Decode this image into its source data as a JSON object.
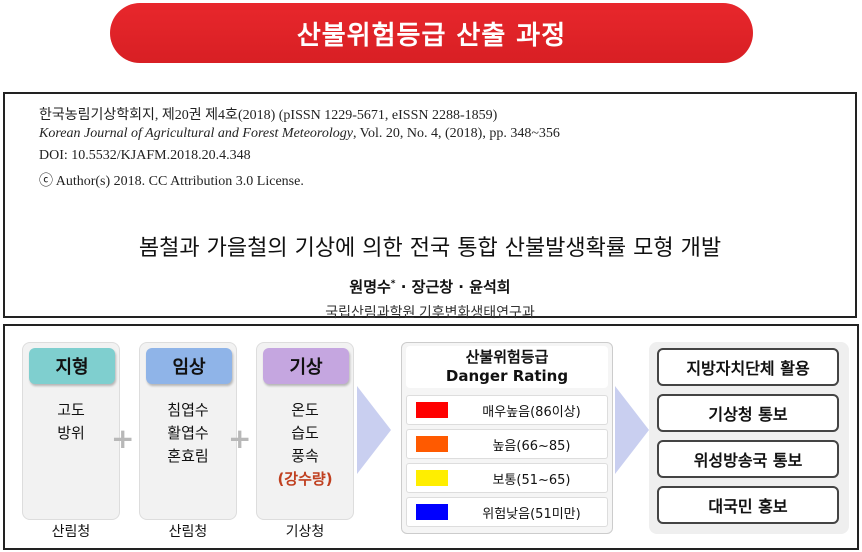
{
  "title": "산불위험등급 산출 과정",
  "paper": {
    "line1": "한국농림기상학회지,  제20권  제4호(2018)  (pISSN  1229-5671,  eISSN  2288-1859)",
    "line2_journal": "Korean Journal of Agricultural and Forest Meteorology",
    "line2_rest": ", Vol.  20,  No.  4,  (2018),  pp.  348~356",
    "line3": "DOI:  10.5532/KJAFM.2018.20.4.348",
    "line4": "ⓒ  Author(s)  2018.  CC  Attribution  3.0  License.",
    "article_title": "봄철과  가을철의  기상에  의한  전국  통합  산불발생확률  모형  개발",
    "authors": "원명수",
    "author_mark": "*",
    "authors_rest": " · 장근창 · 윤석희",
    "affiliation": "국립산림과학원  기후변화생태연구과"
  },
  "diagram": {
    "columns": [
      {
        "head": "지형",
        "head_color": "#7fcfcf",
        "items": [
          "고도",
          "방위"
        ],
        "source": "산림청"
      },
      {
        "head": "임상",
        "head_color": "#8fb4e8",
        "items": [
          "침엽수",
          "활엽수",
          "혼효림"
        ],
        "source": "산림청"
      },
      {
        "head": "기상",
        "head_color": "#c5a6e0",
        "items": [
          "온도",
          "습도",
          "풍속"
        ],
        "highlight": "(강수량)",
        "source": "기상청"
      }
    ],
    "plus": "+",
    "rating": {
      "title_ko": "산불위험등급",
      "title_en": "Danger Rating",
      "rows": [
        {
          "color": "#ff0000",
          "label": "매우높음(86이상)"
        },
        {
          "color": "#ff5a00",
          "label": "높음(66~85)"
        },
        {
          "color": "#ffee00",
          "label": "보통(51~65)"
        },
        {
          "color": "#0000ff",
          "label": "위험낮음(51미만)"
        }
      ]
    },
    "actions": [
      "지방자치단체 활용",
      "기상청 통보",
      "위성방송국 통보",
      "대국민 홍보"
    ]
  }
}
